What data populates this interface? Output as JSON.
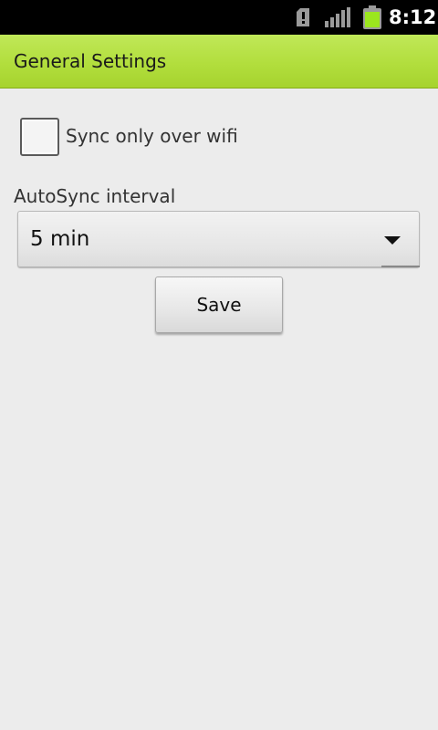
{
  "status_bar": {
    "time": "8:12",
    "icons": [
      "sd-card-alert-icon",
      "signal-icon",
      "battery-icon"
    ],
    "battery_color": "#9be61e"
  },
  "title_bar": {
    "title": "General Settings",
    "color": "#b2de3d"
  },
  "settings": {
    "sync_wifi": {
      "label": "Sync only over wifi",
      "checked": false
    },
    "autosync": {
      "label": "AutoSync interval",
      "selected": "5 min"
    },
    "save_label": "Save"
  }
}
